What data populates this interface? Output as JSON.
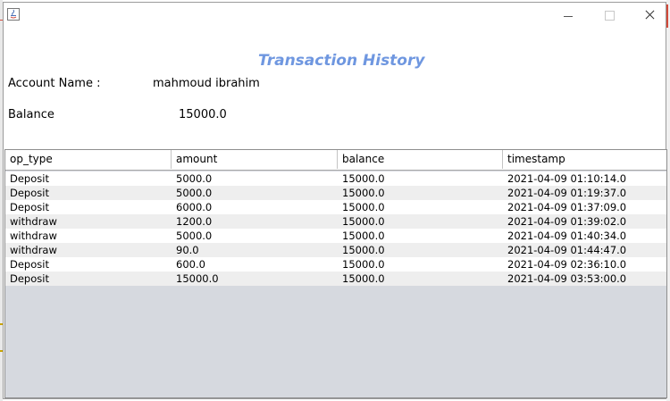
{
  "window": {
    "title_heading": "Transaction History"
  },
  "account": {
    "name_label": "Account Name :",
    "name_value": "mahmoud ibrahim",
    "balance_label": "Balance",
    "balance_value": "15000.0"
  },
  "table": {
    "columns": [
      "op_type",
      "amount",
      "balance",
      "timestamp"
    ],
    "rows": [
      [
        "Deposit",
        "5000.0",
        "15000.0",
        "2021-04-09 01:10:14.0"
      ],
      [
        "Deposit",
        "5000.0",
        "15000.0",
        "2021-04-09 01:19:37.0"
      ],
      [
        "Deposit",
        "6000.0",
        "15000.0",
        "2021-04-09 01:37:09.0"
      ],
      [
        "withdraw",
        "1200.0",
        "15000.0",
        "2021-04-09 01:39:02.0"
      ],
      [
        "withdraw",
        "5000.0",
        "15000.0",
        "2021-04-09 01:40:34.0"
      ],
      [
        "withdraw",
        "90.0",
        "15000.0",
        "2021-04-09 01:44:47.0"
      ],
      [
        "Deposit",
        "600.0",
        "15000.0",
        "2021-04-09 02:36:10.0"
      ],
      [
        "Deposit",
        "15000.0",
        "15000.0",
        "2021-04-09 03:53:00.0"
      ]
    ]
  },
  "icons": {
    "app": "java-app-icon",
    "minimize": "minimize-icon",
    "maximize": "maximize-icon",
    "close": "close-icon"
  }
}
